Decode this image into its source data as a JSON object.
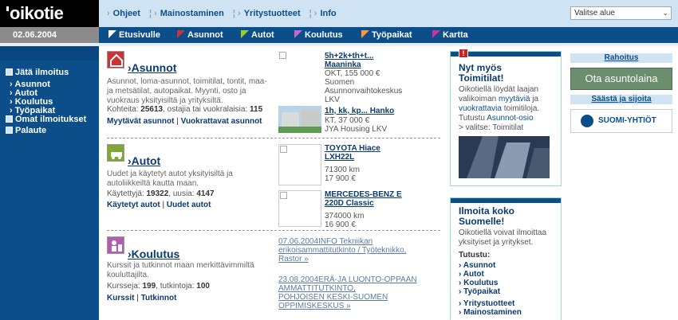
{
  "brand": {
    "logo_text": "oikotie"
  },
  "top_nav": {
    "items": [
      "Ohjeet",
      "Mainostaminen",
      "Yritystuotteet",
      "Info"
    ],
    "region_select": "Valitse alue"
  },
  "date": "02.06.2004",
  "main_nav": {
    "items": [
      "Etusivulle",
      "Asunnot",
      "Autot",
      "Koulutus",
      "Työpaikat",
      "Kartta"
    ],
    "flag_colors": [
      "#ffffff",
      "#cc3333",
      "#99cc33",
      "#cc66cc",
      "#ff9933",
      "#cc3399"
    ]
  },
  "sidebar": {
    "jata": "Jätä ilmoitus",
    "sub": [
      "Asunnot",
      "Autot",
      "Koulutus",
      "Työpaikat"
    ],
    "omat": "Omat ilmoitukset",
    "palaute": "Palaute"
  },
  "sections": {
    "asunnot": {
      "title": "›Asunnot",
      "desc": "Asunnot, loma-asunnot, toimitilat, tontit, maa- ja metsätilat, autopaikat. Myynti, osto ja vuokraus yksityisiltä ja yrityksiltä.",
      "stat_label": "Kohteita: ",
      "stat_value": "25613",
      "stat_rest": ", ostajia tai vuokralaisia: ",
      "stat_value2": "115",
      "link1": "Myytävät asunnot",
      "link2": "Vuokrattavat asunnot"
    },
    "autot": {
      "title": "›Autot",
      "desc": "Uudet ja käytetyt autot yksityisiltä ja autoliikkeiltä kautta maan.",
      "stat_label": "Käytettyjä: ",
      "stat_value": "19322",
      "stat_rest": ", uusia: ",
      "stat_value2": "4147",
      "link1": "Käytetyt autot",
      "link2": "Uudet autot"
    },
    "koulutus": {
      "title": "›Koulutus",
      "desc": "Kurssit ja tutkinnot maan merkittävimmiltä kouluttajilta.",
      "stat_label": "Kursseja: ",
      "stat_value": "199",
      "stat_rest": ", tutkintoja: ",
      "stat_value2": "100",
      "link1": "Kurssit",
      "link2": "Tutkinnot"
    }
  },
  "listings": {
    "asunto1": {
      "title": "5h+2k+th+t...",
      "title2": "Maaninka",
      "lines": [
        "OKT, 155 000 €",
        "Suomen",
        "Asunnonvaihtokeskus",
        "LKV"
      ]
    },
    "asunto2": {
      "title": "1h, kk, kp... Hanko",
      "lines": [
        "KT, 37 000 €",
        "JYA Housing LKV"
      ]
    },
    "auto1": {
      "title": "TOYOTA Hiace",
      "title2": "LXH22L",
      "lines": [
        "71300 km",
        "17 900 €"
      ]
    },
    "auto2": {
      "title": "MERCEDES-BENZ E",
      "title2": "220D Classic",
      "lines": [
        "374000 km",
        "16 900 €"
      ]
    }
  },
  "news": [
    {
      "text1": "07.06.2004INFO Tekniikan",
      "text2": "erikoisammattitutkinto / Työteknikko,",
      "text3": "Rastor »"
    },
    {
      "text1": "23.08.2004ERÄ-JA LUONTO-OPPAAN",
      "text2": "AMMATTITUTKINTO,",
      "text3": "POHJOISEN KESKI-SUOMEN",
      "text4": "OPPIMISKESKUS »"
    }
  ],
  "right": {
    "box1": {
      "heading1": "Nyt myös",
      "heading2": "Toimitilat!",
      "t1": "Oikotiellä löydät laajan",
      "t2a": "valikoiman ",
      "t2b": "myytäviä",
      "t2c": " ja",
      "t3a": "vuokrattavia",
      "t3b": " toimitiloja.",
      "t4a": "Tutustu ",
      "t4b": "Asunnot-osio",
      "t5": "> valitse: Toimitilat"
    },
    "box2": {
      "heading1": "Ilmoita koko",
      "heading2": "Suomelle!",
      "t1": "Oikotiellä voivat ilmoittaa",
      "t2": "yksityiset ja yritykset.",
      "tutustu": "Tutustu:",
      "items": [
        "› Asunnot",
        "› Autot",
        "› Koulutus",
        "› Työpaikat"
      ],
      "items2": [
        "› Yritystuotteet",
        "› Mainostaminen"
      ]
    }
  },
  "ads": {
    "rahoitus": "Rahoitus",
    "ota": "Ota asuntolaina",
    "saasta": "Säästä ja sijoita",
    "suomi": "SUOMI-YHTIÖT"
  }
}
